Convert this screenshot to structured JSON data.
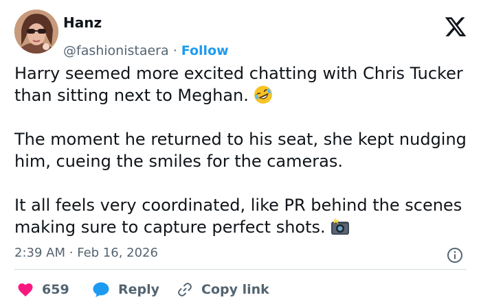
{
  "author": {
    "name": "Hanz",
    "handle": "@fashionistaera",
    "separator": "·",
    "follow_label": "Follow"
  },
  "tweet": {
    "paragraphs": [
      "Harry seemed more excited chatting with Chris Tucker than sitting next to Meghan.",
      "The moment he returned to his seat, she kept nudging him, cueing the smiles for the cameras.",
      "It all feels very coordinated, like PR behind the scenes making sure to capture perfect shots."
    ],
    "emojis": [
      "rolling-on-floor-laughing-emoji",
      "camera-with-flash-emoji"
    ]
  },
  "meta": {
    "time": "2:39 AM",
    "separator": "·",
    "date": "Feb 16, 2026"
  },
  "actions": {
    "likes_count": "659",
    "reply_label": "Reply",
    "copy_link_label": "Copy link"
  },
  "colors": {
    "like": "#f91880",
    "reply": "#1d9bf0",
    "link": "#1d9bf0",
    "muted": "#536471",
    "text": "#0f1419"
  },
  "icons": [
    "x-logo-icon",
    "info-icon",
    "heart-icon",
    "reply-bubble-icon",
    "link-icon"
  ]
}
